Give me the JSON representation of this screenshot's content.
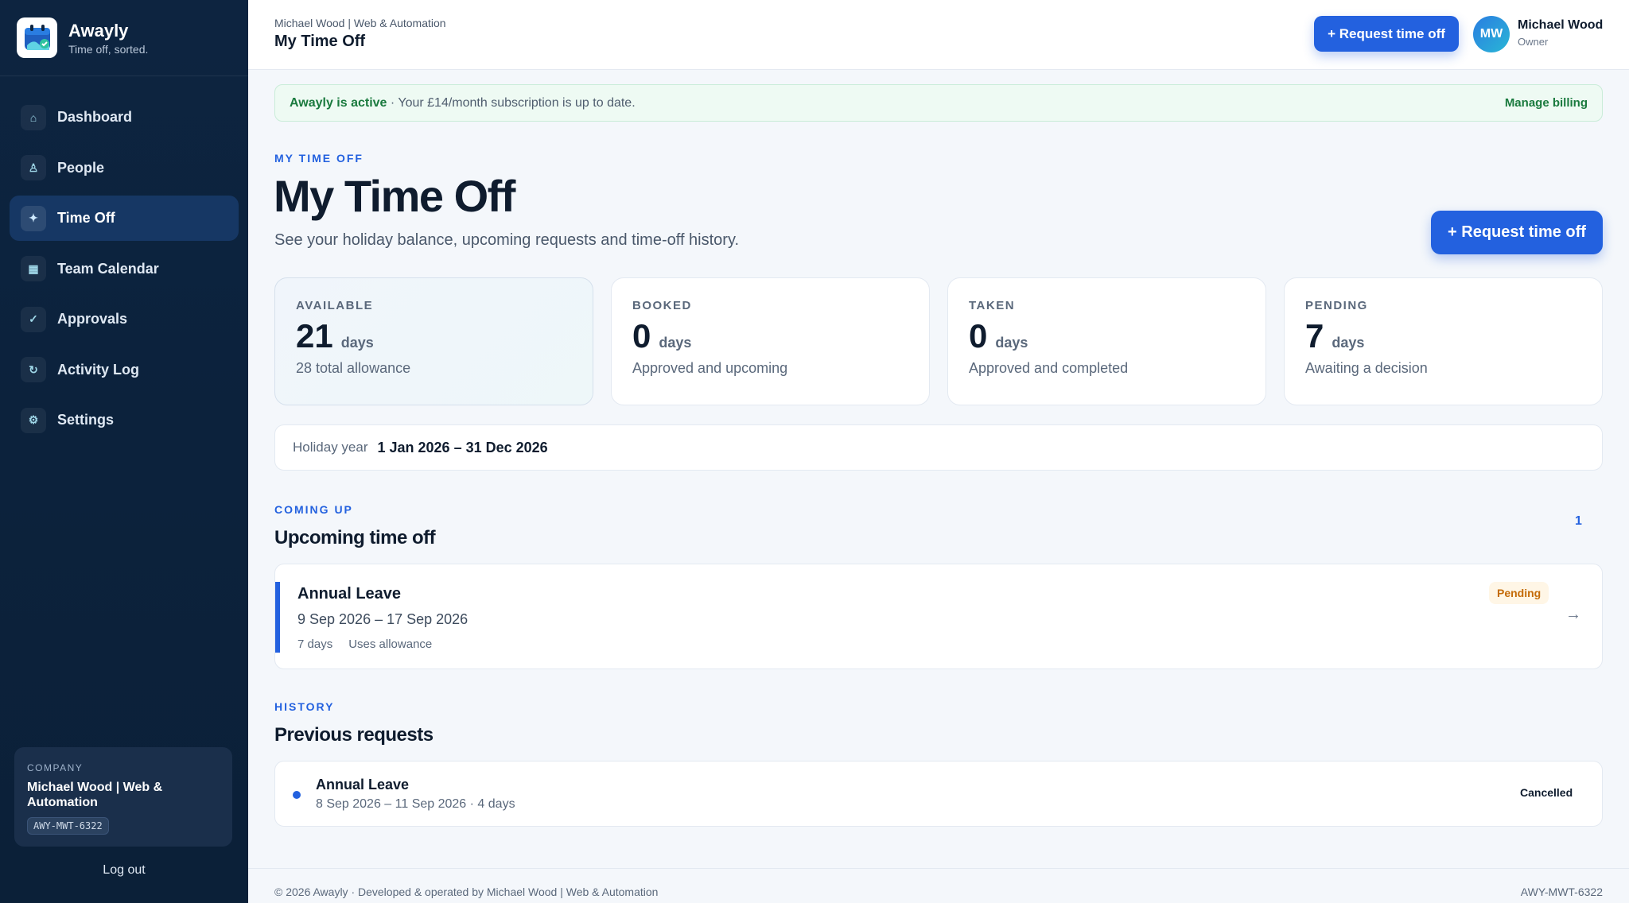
{
  "brand": {
    "name": "Awayly",
    "tagline": "Time off, sorted."
  },
  "sidebar": {
    "items": [
      {
        "label": "Dashboard",
        "icon": "home-icon",
        "glyph": "⌂"
      },
      {
        "label": "People",
        "icon": "people-icon",
        "glyph": "♙"
      },
      {
        "label": "Time Off",
        "icon": "sparkle-icon",
        "glyph": "✦"
      },
      {
        "label": "Team Calendar",
        "icon": "calendar-icon",
        "glyph": "▦"
      },
      {
        "label": "Approvals",
        "icon": "check-icon",
        "glyph": "✓"
      },
      {
        "label": "Activity Log",
        "icon": "history-icon",
        "glyph": "↻"
      },
      {
        "label": "Settings",
        "icon": "gear-icon",
        "glyph": "⚙"
      }
    ],
    "active": "Time Off",
    "company": {
      "label": "COMPANY",
      "name": "Michael Wood | Web & Automation",
      "code": "AWY-MWT-6322"
    },
    "logout": "Log out"
  },
  "header": {
    "breadcrumb": "Michael Wood | Web & Automation",
    "title": "My Time Off",
    "request_button": "+ Request time off",
    "user": {
      "initials": "MW",
      "name": "Michael Wood",
      "role": "Owner"
    }
  },
  "alert": {
    "strong": "Awayly is active",
    "text": " · Your £14/month subscription is up to date.",
    "link": "Manage billing"
  },
  "page": {
    "eyebrow": "MY TIME OFF",
    "title": "My Time Off",
    "subtitle": "See your holiday balance, upcoming requests and time-off history.",
    "request_button": "+ Request time off"
  },
  "stats": [
    {
      "label": "AVAILABLE",
      "value": "21",
      "unit": "days",
      "desc": "28 total allowance"
    },
    {
      "label": "BOOKED",
      "value": "0",
      "unit": "days",
      "desc": "Approved and upcoming"
    },
    {
      "label": "TAKEN",
      "value": "0",
      "unit": "days",
      "desc": "Approved and completed"
    },
    {
      "label": "PENDING",
      "value": "7",
      "unit": "days",
      "desc": "Awaiting a decision"
    }
  ],
  "holiday_year": {
    "label": "Holiday year",
    "value": "1 Jan 2026 – 31 Dec 2026"
  },
  "upcoming": {
    "eyebrow": "COMING UP",
    "title": "Upcoming time off",
    "count": "1",
    "items": [
      {
        "type": "Annual Leave",
        "dates": "9 Sep 2026 – 17 Sep 2026",
        "days": "7 days",
        "note": "Uses allowance",
        "status": "Pending"
      }
    ]
  },
  "history": {
    "eyebrow": "HISTORY",
    "title": "Previous requests",
    "items": [
      {
        "type": "Annual Leave",
        "detail": "8 Sep 2026 – 11 Sep 2026 · 4 days",
        "status": "Cancelled"
      }
    ]
  },
  "footer": {
    "left": "© 2026 Awayly · Developed & operated by Michael Wood | Web & Automation",
    "right": "AWY-MWT-6322"
  },
  "colors": {
    "accent": "#2361df",
    "sidebar": "#0d2440",
    "success": "#1a7a3e",
    "pending": "#c46b08"
  }
}
